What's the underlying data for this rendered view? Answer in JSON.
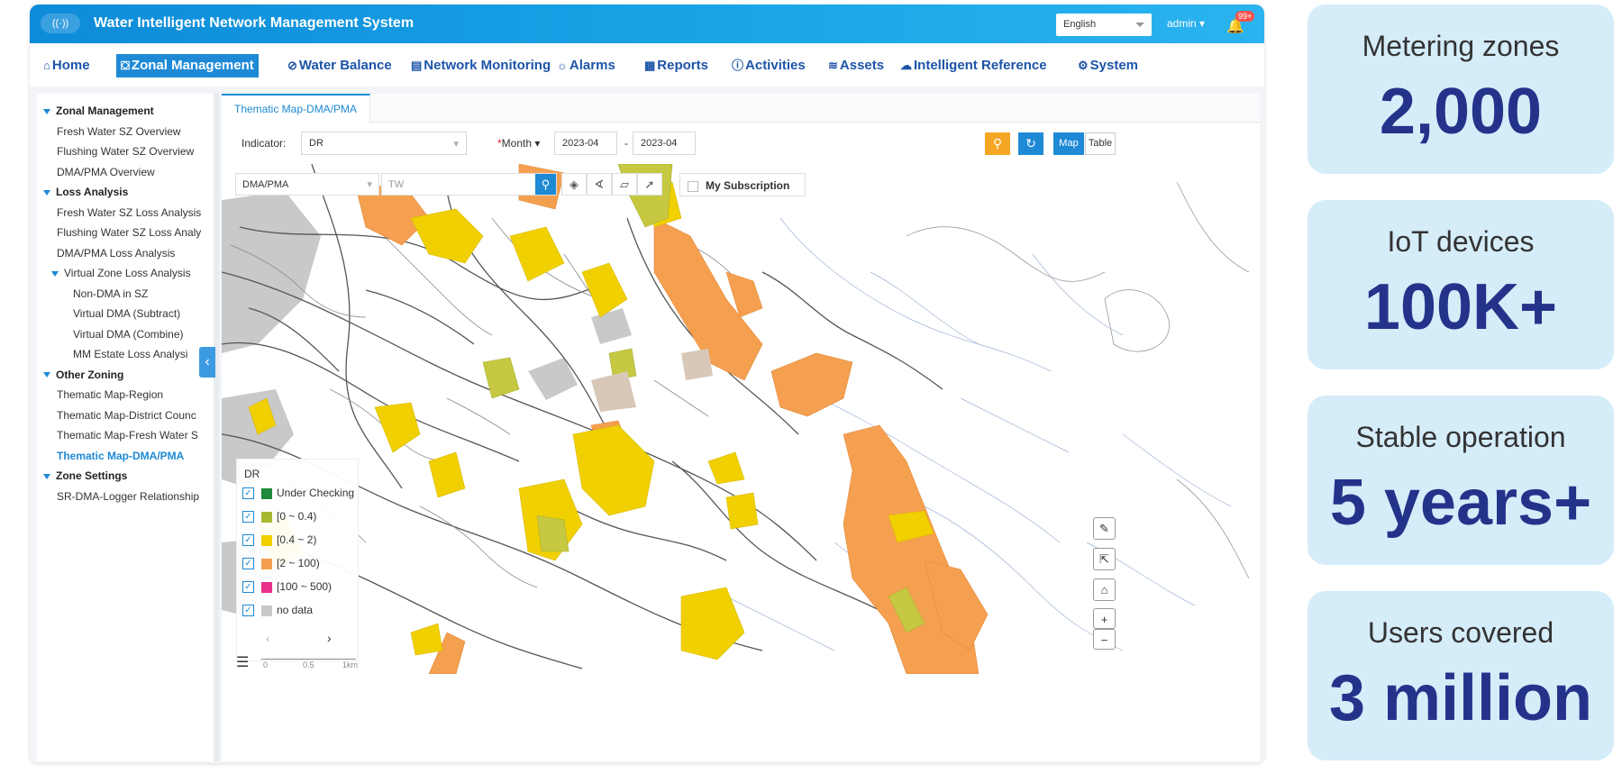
{
  "header": {
    "logo": "((·))",
    "title": "Water Intelligent Network Management System",
    "language": "English",
    "user": "admin",
    "notifications": "99+"
  },
  "menu": [
    {
      "label": "Home",
      "icon": "home-icon",
      "glyph": "⌂"
    },
    {
      "label": "Zonal Management",
      "icon": "zone-icon",
      "glyph": "⛋"
    },
    {
      "label": "Water Balance",
      "icon": "balance-icon",
      "glyph": "⊘"
    },
    {
      "label": "Network Monitoring",
      "icon": "monitor-icon",
      "glyph": "▤"
    },
    {
      "label": "Alarms",
      "icon": "alarm-icon",
      "glyph": "☼"
    },
    {
      "label": "Reports",
      "icon": "report-icon",
      "glyph": "▦"
    },
    {
      "label": "Activities",
      "icon": "info-icon",
      "glyph": "ⓘ"
    },
    {
      "label": "Assets",
      "icon": "layers-icon",
      "glyph": "≋"
    },
    {
      "label": "Intelligent Reference",
      "icon": "cloud-icon",
      "glyph": "☁"
    },
    {
      "label": "System",
      "icon": "gear-icon",
      "glyph": "⚙"
    }
  ],
  "sidebar": {
    "items": [
      {
        "label": "Zonal Management",
        "type": "group"
      },
      {
        "label": "Fresh Water SZ Overview",
        "type": "item"
      },
      {
        "label": "Flushing Water SZ Overview",
        "type": "item"
      },
      {
        "label": "DMA/PMA Overview",
        "type": "item"
      },
      {
        "label": "Loss Analysis",
        "type": "group"
      },
      {
        "label": "Fresh Water SZ Loss Analysis",
        "type": "item"
      },
      {
        "label": "Flushing Water SZ Loss Analy",
        "type": "item"
      },
      {
        "label": "DMA/PMA Loss Analysis",
        "type": "item"
      },
      {
        "label": "Virtual Zone Loss Analysis",
        "type": "subgroup"
      },
      {
        "label": "Non-DMA in SZ",
        "type": "sub"
      },
      {
        "label": "Virtual DMA (Subtract)",
        "type": "sub"
      },
      {
        "label": "Virtual DMA (Combine)",
        "type": "sub"
      },
      {
        "label": "MM Estate Loss Analysi",
        "type": "sub"
      },
      {
        "label": "Other Zoning",
        "type": "group"
      },
      {
        "label": "Thematic Map-Region",
        "type": "item"
      },
      {
        "label": "Thematic Map-District Counc",
        "type": "item"
      },
      {
        "label": "Thematic Map-Fresh Water S",
        "type": "item"
      },
      {
        "label": "Thematic Map-DMA/PMA",
        "type": "item",
        "active": true
      },
      {
        "label": "Zone Settings",
        "type": "group"
      },
      {
        "label": "SR-DMA-Logger Relationship",
        "type": "item"
      }
    ],
    "collapse_glyph": "‹"
  },
  "tab": {
    "label": "Thematic Map-DMA/PMA"
  },
  "filters": {
    "indicator_label": "Indicator:",
    "indicator_value": "DR",
    "period_label": "Month",
    "required_mark": "*",
    "from": "2023-04",
    "dash": "-",
    "to": "2023-04",
    "map_toggle": "Map",
    "table_toggle": "Table"
  },
  "map": {
    "zone_type": "DMA/PMA",
    "search_placeholder": "TW",
    "subscription": "My Subscription",
    "legend_title": "DR",
    "legend": [
      {
        "label": "Under Checking",
        "color": "#1e8a3a"
      },
      {
        "label": "[0 ~ 0.4)",
        "color": "#a8b830"
      },
      {
        "label": "[0.4 ~ 2)",
        "color": "#f0d000"
      },
      {
        "label": "[2 ~ 100)",
        "color": "#f5a050"
      },
      {
        "label": "[100 ~ 500)",
        "color": "#e8308a"
      },
      {
        "label": "no data",
        "color": "#c8c8c8"
      }
    ],
    "legend_prev": "‹",
    "legend_next": "›",
    "scale": [
      "0",
      "0.5",
      "1km"
    ]
  },
  "stats": [
    {
      "label": "Metering zones",
      "value": "2,000"
    },
    {
      "label": "IoT devices",
      "value": "100K+"
    },
    {
      "label": "Stable operation",
      "value": "5 years+"
    },
    {
      "label": "Users covered",
      "value": "3 million"
    }
  ],
  "colors": {
    "accent": "#1e8ad6",
    "orange": "#f5a623",
    "stat_bg": "#d5ecf9",
    "stat_text": "#24338a"
  }
}
